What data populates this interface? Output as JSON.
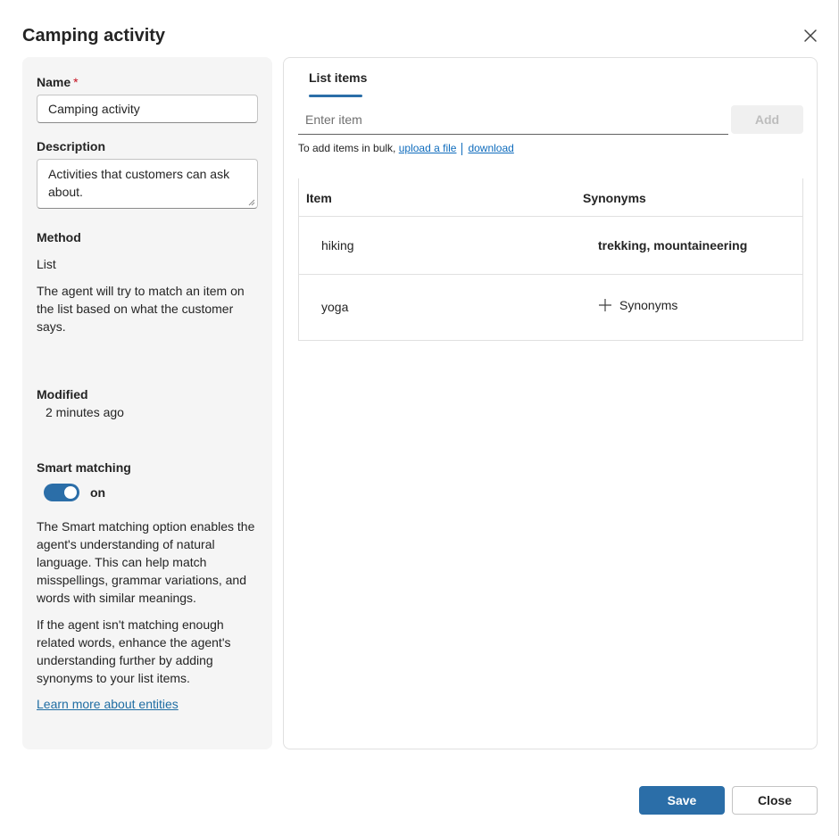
{
  "dialog": {
    "title": "Camping activity"
  },
  "left": {
    "name_label": "Name",
    "required_mark": "*",
    "name_value": "Camping activity",
    "description_label": "Description",
    "description_value": "Activities that customers can ask about.",
    "method_label": "Method",
    "method_value": "List",
    "method_help": "The agent will try to match an item on the list based on what the customer says.",
    "modified_label": "Modified",
    "modified_value": "2 minutes ago",
    "smart_label": "Smart matching",
    "smart_state": "on",
    "smart_help_1": "The Smart matching option enables the agent's understanding of natural language. This can help match misspellings, grammar variations, and words with similar meanings.",
    "smart_help_2": "If the agent isn't matching enough related words, enhance the agent's understanding further by adding synonyms to your list items.",
    "learn_more": "Learn more about entities"
  },
  "right": {
    "tab": "List items",
    "enter_placeholder": "Enter item",
    "add_label": "Add",
    "bulk_prefix": "To add items in bulk,",
    "upload_link": "upload a file",
    "download_link": "download",
    "columns": {
      "item": "Item",
      "synonyms": "Synonyms"
    },
    "rows": [
      {
        "item": "hiking",
        "synonyms": "trekking, mountaineering"
      },
      {
        "item": "yoga",
        "synonyms": "",
        "add_synonyms_label": "Synonyms"
      }
    ]
  },
  "footer": {
    "save": "Save",
    "close": "Close"
  },
  "colors": {
    "accent": "#2b6ea8",
    "link": "#0f6cbd",
    "required": "#c50f1f",
    "panel_bg": "#f5f5f5"
  }
}
